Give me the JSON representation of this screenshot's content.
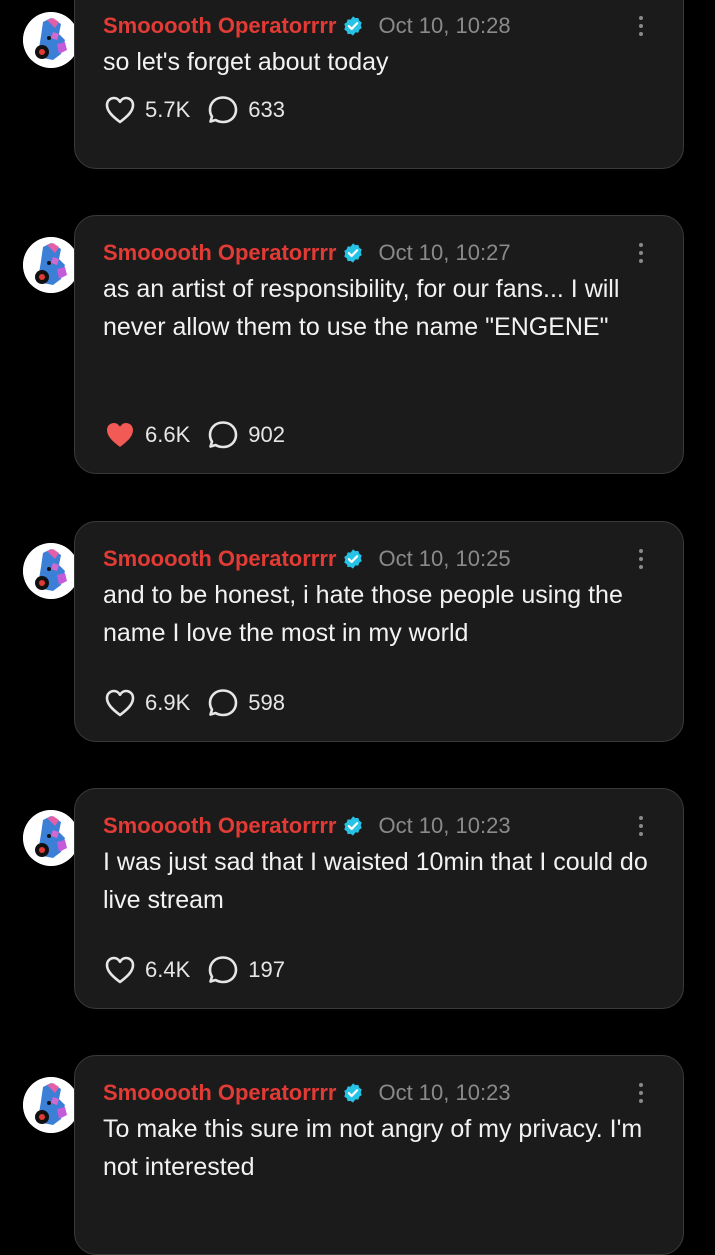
{
  "author": {
    "name": "Smooooth Operatorrrr",
    "verified_icon": "verified-badge-icon",
    "name_color": "#e23b36"
  },
  "colors": {
    "background": "#000000",
    "card": "#1b1b1b",
    "card_border": "#3a3a3a",
    "liked_heart": "#f25a55",
    "verified": "#27c3e6"
  },
  "posts": [
    {
      "time": "Oct 10, 10:28",
      "text": "so let's forget about today",
      "likes": "5.7K",
      "replies": "633",
      "liked": false
    },
    {
      "time": "Oct 10, 10:27",
      "text": "as an artist of responsibility, for our fans... I will never allow them to use the name \"ENGENE\"",
      "likes": "6.6K",
      "replies": "902",
      "liked": true
    },
    {
      "time": "Oct 10, 10:25",
      "text": "and to be honest, i hate those people using the name I love the most in my world",
      "likes": "6.9K",
      "replies": "598",
      "liked": false
    },
    {
      "time": "Oct 10, 10:23",
      "text": "I was just sad that I waisted 10min that I could do live stream",
      "likes": "6.4K",
      "replies": "197",
      "liked": false
    },
    {
      "time": "Oct 10, 10:23",
      "text": "To make this sure im not angry of my privacy. I'm not interested",
      "likes": null,
      "replies": null,
      "liked": false
    }
  ]
}
